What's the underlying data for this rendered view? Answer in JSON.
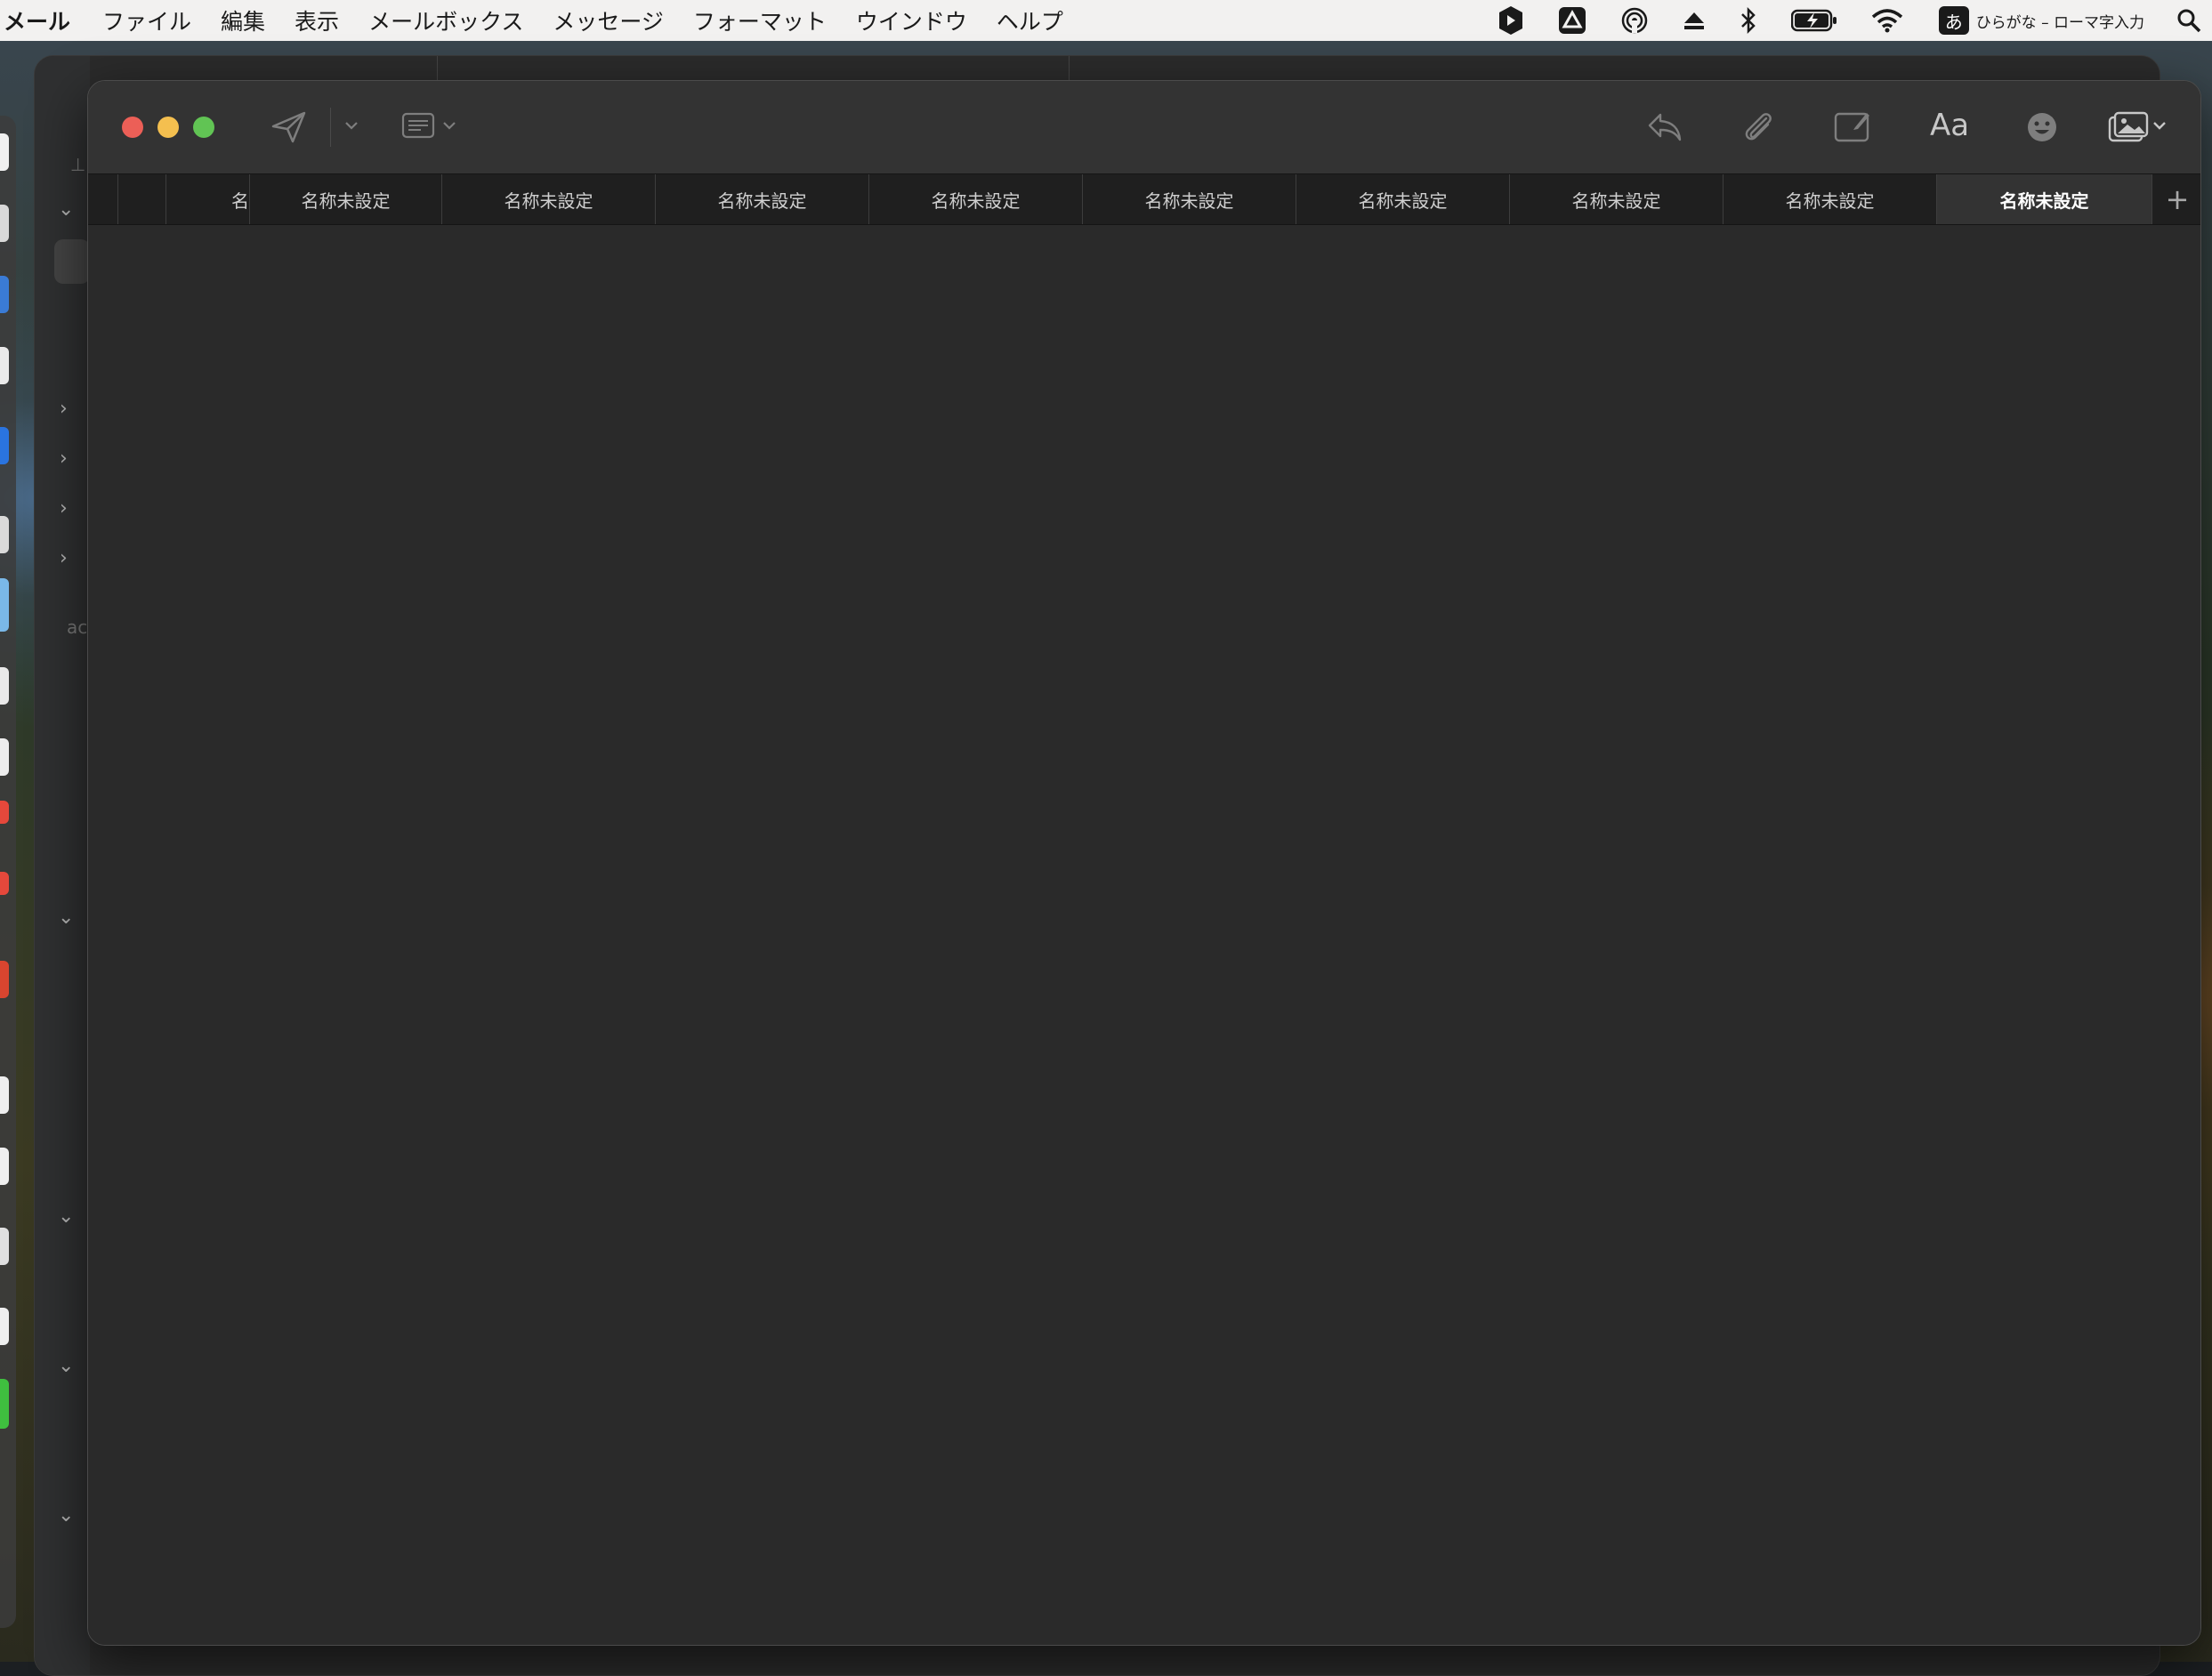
{
  "menubar": {
    "app_name": "メール",
    "items": [
      "ファイル",
      "編集",
      "表示",
      "メールボックス",
      "メッセージ",
      "フォーマット",
      "ウインドウ",
      "ヘルプ"
    ],
    "ime_badge": "あ",
    "ime_label": "ひらがな – ローマ字入力"
  },
  "compose": {
    "toolbar_icons": [
      "send-icon",
      "send-options-chevron-icon",
      "header-fields-icon",
      "reply-icon",
      "attachment-icon",
      "markup-icon",
      "format-icon",
      "emoji-icon",
      "photo-browser-icon"
    ],
    "format_label": "Aa",
    "tabs": [
      {
        "label": ""
      },
      {
        "label": ""
      },
      {
        "label": "名"
      },
      {
        "label": "名称未設定"
      },
      {
        "label": "名称未設定"
      },
      {
        "label": "名称未設定"
      },
      {
        "label": "名称未設定"
      },
      {
        "label": "名称未設定"
      },
      {
        "label": "名称未設定"
      },
      {
        "label": "名称未設定"
      },
      {
        "label": "名称未設定"
      },
      {
        "label": "名称未設定"
      }
    ],
    "new_tab_label": "+"
  },
  "background_window": {
    "sidebar_fragment": "ac"
  },
  "colors": {
    "close": "#ec5f57",
    "minimize": "#f4bf4f",
    "zoom": "#61c454",
    "active_tab_bg": "#333333"
  }
}
